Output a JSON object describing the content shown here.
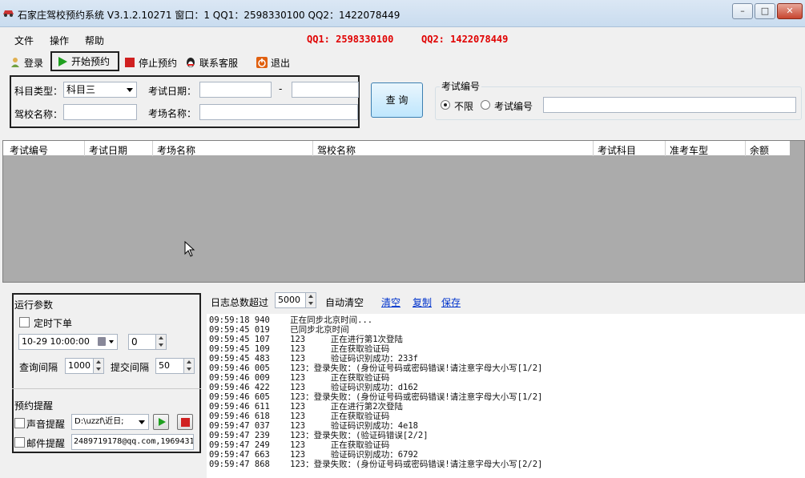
{
  "window": {
    "title": "石家庄驾校预约系统 V3.1.2.10271 窗口：1  QQ1：2598330100   QQ2：1422078449",
    "min": "–",
    "max": "□",
    "close": "✕"
  },
  "menu": {
    "items": [
      "文件",
      "操作",
      "帮助"
    ],
    "qq1": "QQ1: 2598330100",
    "qq2": "QQ2: 1422078449"
  },
  "toolbar": {
    "login": "登录",
    "start": "开始预约",
    "stop": "停止预约",
    "contact": "联系客服",
    "exit": "退出"
  },
  "search": {
    "subject_label": "科目类型：",
    "subject_value": "科目三",
    "date_label": "考试日期：",
    "date_sep": "-",
    "school_label": "驾校名称：",
    "site_label": "考场名称：",
    "query_button": "查 询"
  },
  "exam_no": {
    "legend": "考试编号",
    "opt_all": "不限",
    "opt_no": "考试编号"
  },
  "grid": {
    "columns": [
      "考试编号",
      "考试日期",
      "考场名称",
      "驾校名称",
      "考试科目",
      "准考车型",
      "余额"
    ]
  },
  "params": {
    "legend": "运行参数",
    "timer_label": "定时下单",
    "datetime": "10-29 10:00:00",
    "seconds": "0",
    "query_interval_label": "查询间隔",
    "query_interval": "1000",
    "submit_interval_label": "提交间隔",
    "submit_interval": "50"
  },
  "remind": {
    "legend": "预约提醒",
    "sound_label": "声音提醒",
    "sound_path": "D:\\uzzf\\近日;",
    "mail_label": "邮件提醒",
    "mail_value": "2489719178@qq.com,1969431"
  },
  "logbar": {
    "limit_label": "日志总数超过",
    "limit_value": "5000",
    "auto_clear": "自动清空",
    "clear": "清空",
    "copy": "复制",
    "save": "保存"
  },
  "log": [
    "09:59:18 940    正在同步北京时间...",
    "09:59:45 019    已同步北京时间",
    "09:59:45 107    123     正在进行第1次登陆",
    "09:59:45 109    123     正在获取验证码",
    "09:59:45 483    123     验证码识别成功：233f",
    "09:59:46 005    123：登录失败：(身份证号码或密码错误!请注意字母大小写[1/2]",
    "09:59:46 009    123     正在获取验证码",
    "09:59:46 422    123     验证码识别成功：d162",
    "09:59:46 605    123：登录失败：(身份证号码或密码错误!请注意字母大小写[1/2]",
    "09:59:46 611    123     正在进行第2次登陆",
    "09:59:46 618    123     正在获取验证码",
    "09:59:47 037    123     验证码识别成功：4e18",
    "09:59:47 239    123：登录失败：(验证码错误[2/2]",
    "09:59:47 249    123     正在获取验证码",
    "09:59:47 663    123     验证码识别成功：6792",
    "09:59:47 868    123：登录失败：(身份证号码或密码错误!请注意字母大小写[2/2]"
  ]
}
